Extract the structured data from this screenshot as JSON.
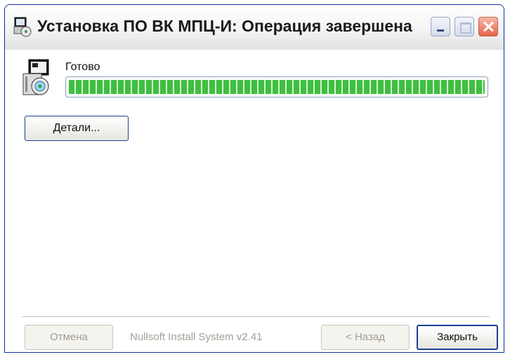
{
  "window": {
    "title": "Установка ПО ВК МПЦ-И: Операция завершена",
    "icon": "installer-icon"
  },
  "status": {
    "text": "Готово",
    "progress_fraction": 1.0
  },
  "buttons": {
    "details": "Детали...",
    "cancel": "Отмена",
    "back": "< Назад",
    "close": "Закрыть"
  },
  "branding": "Nullsoft Install System v2.41",
  "colors": {
    "progress_green": "#3fbf3f",
    "titlebar_close": "#e5644a"
  }
}
